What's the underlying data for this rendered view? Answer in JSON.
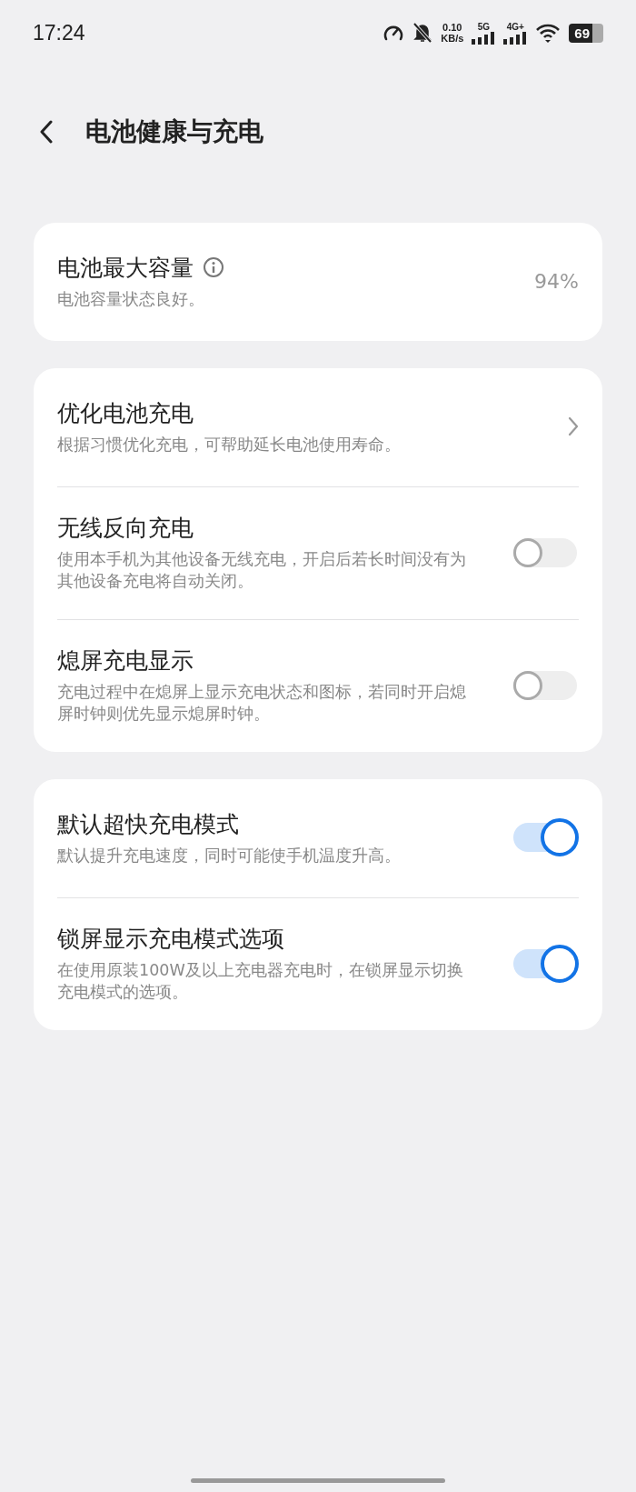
{
  "status_bar": {
    "time": "17:24",
    "speed_value": "0.10",
    "speed_unit": "KB/s",
    "network_1": "5G",
    "network_2": "4G+",
    "battery": "69"
  },
  "header": {
    "title": "电池健康与充电"
  },
  "groups": [
    {
      "rows": [
        {
          "kind": "value",
          "title": "电池最大容量",
          "info": true,
          "subtitle": "电池容量状态良好。",
          "value": "94%"
        }
      ]
    },
    {
      "rows": [
        {
          "kind": "link",
          "title": "优化电池充电",
          "info": false,
          "subtitle": "根据习惯优化充电，可帮助延长电池使用寿命。"
        },
        {
          "kind": "toggle",
          "title": "无线反向充电",
          "info": false,
          "subtitle": "使用本手机为其他设备无线充电，开启后若长时间没有为其他设备充电将自动关闭。",
          "on": false
        },
        {
          "kind": "toggle",
          "title": "熄屏充电显示",
          "info": false,
          "subtitle": "充电过程中在熄屏上显示充电状态和图标，若同时开启熄屏时钟则优先显示熄屏时钟。",
          "on": false
        }
      ]
    },
    {
      "rows": [
        {
          "kind": "toggle",
          "title": "默认超快充电模式",
          "info": false,
          "subtitle": "默认提升充电速度，同时可能使手机温度升高。",
          "on": true
        },
        {
          "kind": "toggle",
          "title": "锁屏显示充电模式选项",
          "info": false,
          "subtitle": "在使用原装100W及以上充电器充电时，在锁屏显示切换充电模式的选项。",
          "on": true
        }
      ]
    }
  ]
}
